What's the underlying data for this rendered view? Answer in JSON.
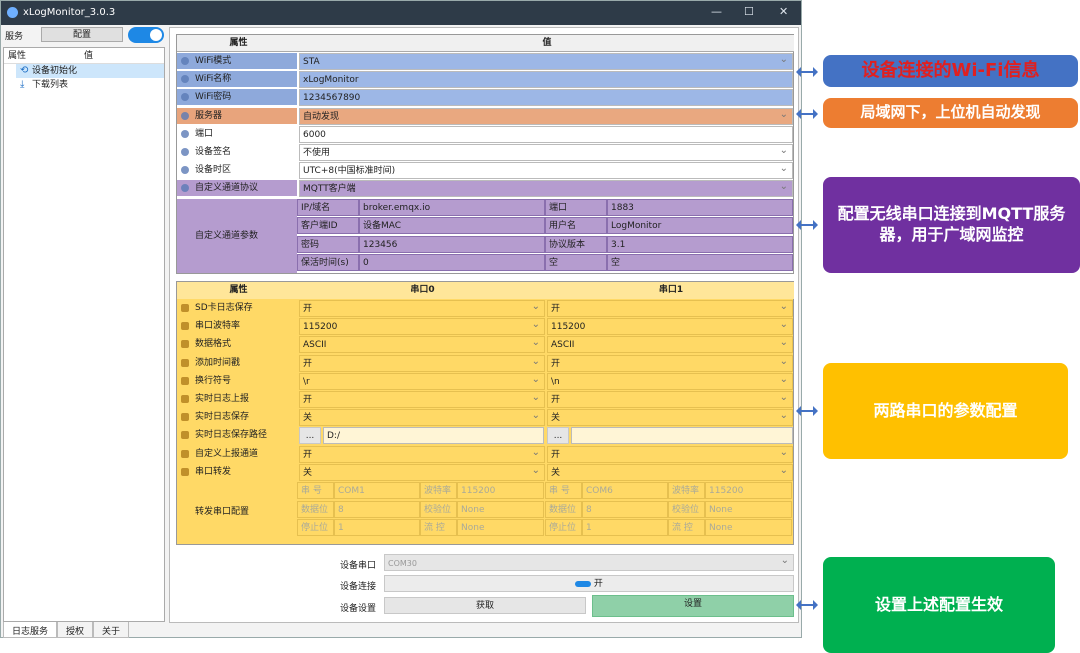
{
  "window": {
    "title": "xLogMonitor_3.0.3",
    "min": "—",
    "max": "☐",
    "close": "✕"
  },
  "toolbar": {
    "service": "服务",
    "config": "配置"
  },
  "sidebar": {
    "col_attr": "属性",
    "col_val": "值",
    "items": [
      "设备初始化",
      "下载列表"
    ]
  },
  "bottom_tabs": [
    "日志服务",
    "授权",
    "关于"
  ],
  "t1": {
    "h_attr": "属性",
    "h_val": "值",
    "rows": [
      {
        "k": "WiFi模式",
        "v": "STA",
        "dd": true,
        "c": "#8ea9db",
        "cv": "#9db7e6"
      },
      {
        "k": "WiFi名称",
        "v": "xLogMonitor",
        "dd": false,
        "c": "#8ea9db",
        "cv": "#9db7e6"
      },
      {
        "k": "WiFi密码",
        "v": "1234567890",
        "dd": false,
        "c": "#8ea9db",
        "cv": "#9db7e6"
      },
      {
        "k": "服务器",
        "v": "自动发现",
        "dd": true,
        "c": "#e8a47c",
        "cv": "#e9a880"
      },
      {
        "k": "端口",
        "v": "6000",
        "dd": false,
        "c": "#fff",
        "cv": "#fff"
      },
      {
        "k": "设备签名",
        "v": "不使用",
        "dd": true,
        "c": "#fff",
        "cv": "#fff"
      },
      {
        "k": "设备时区",
        "v": "UTC+8(中国标准时间)",
        "dd": true,
        "c": "#fff",
        "cv": "#fff"
      },
      {
        "k": "自定义通道协议",
        "v": "MQTT客户端",
        "dd": true,
        "c": "#b59ccf",
        "cv": "#b59ccf"
      }
    ],
    "param_label": "自定义通道参数",
    "params": [
      [
        "IP/域名",
        "broker.emqx.io",
        "端口",
        "1883"
      ],
      [
        "客户端ID",
        "设备MAC",
        "用户名",
        "LogMonitor"
      ],
      [
        "密码",
        "123456",
        "协议版本",
        "3.1"
      ],
      [
        "保活时间(s)",
        "0",
        "空",
        "空"
      ]
    ]
  },
  "t2": {
    "h_attr": "属性",
    "h_c0": "串口0",
    "h_c1": "串口1",
    "rows": [
      {
        "k": "SD卡日志保存",
        "a": "开",
        "b": "开"
      },
      {
        "k": "串口波特率",
        "a": "115200",
        "b": "115200"
      },
      {
        "k": "数据格式",
        "a": "ASCII",
        "b": "ASCII"
      },
      {
        "k": "添加时间戳",
        "a": "开",
        "b": "开"
      },
      {
        "k": "换行符号",
        "a": "\\r",
        "b": "\\n"
      },
      {
        "k": "实时日志上报",
        "a": "开",
        "b": "开"
      },
      {
        "k": "实时日志保存",
        "a": "关",
        "b": "关"
      },
      {
        "k": "实时日志保存路径",
        "a": "D:/",
        "b": ""
      },
      {
        "k": "自定义上报通道",
        "a": "开",
        "b": "开"
      },
      {
        "k": "串口转发",
        "a": "关",
        "b": "关"
      }
    ],
    "fwd_label": "转发串口配置",
    "browse": "...",
    "fwd": [
      [
        [
          "串  号",
          "COM1",
          "波特率",
          "115200"
        ],
        [
          "串  号",
          "COM6",
          "波特率",
          "115200"
        ]
      ],
      [
        [
          "数据位",
          "8",
          "校验位",
          "None"
        ],
        [
          "数据位",
          "8",
          "校验位",
          "None"
        ]
      ],
      [
        [
          "停止位",
          "1",
          "流  控",
          "None"
        ],
        [
          "停止位",
          "1",
          "流  控",
          "None"
        ]
      ]
    ]
  },
  "device": {
    "port_label": "设备串口",
    "port_value": "COM30",
    "connect_label": "设备连接",
    "connect_state": "开",
    "settings_label": "设备设置",
    "get_btn": "获取",
    "set_btn": "设置"
  },
  "annotations": [
    {
      "text": "设备连接的Wi-Fi信息",
      "color": "#4472c4",
      "fg": "#e02020"
    },
    {
      "text": "局域网下，上位机自动发现",
      "color": "#ed7d31",
      "fg": "#ffffff"
    },
    {
      "text": "配置无线串口连接到MQTT服务器，用于广域网监控",
      "color": "#7030a0",
      "fg": "#ffffff"
    },
    {
      "text": "两路串口的参数配置",
      "color": "#ffc000",
      "fg": "#ffffff"
    },
    {
      "text": "设置上述配置生效",
      "color": "#00b050",
      "fg": "#ffffff"
    }
  ]
}
